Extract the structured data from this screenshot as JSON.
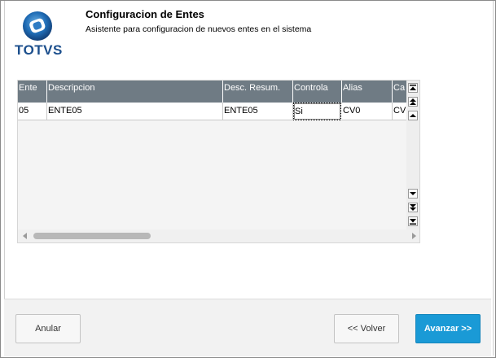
{
  "header": {
    "logo_text": "TOTVS",
    "title": "Configuracion de Entes",
    "subtitle": "Asistente para configuracion de nuevos entes en el sistema"
  },
  "grid": {
    "columns": [
      "Ente",
      "Descripcion",
      "Desc. Resum.",
      "Controla",
      "Alias",
      "Ca"
    ],
    "rows": [
      [
        "05",
        "ENTE05",
        "ENTE05",
        "Si",
        "CV0",
        "CV"
      ]
    ]
  },
  "footer": {
    "cancel_label": "Anular",
    "back_label": "<< Volver",
    "next_label": "Avanzar >>"
  },
  "colors": {
    "header_bg": "#6f7b84",
    "primary": "#1a9ad6",
    "brand": "#1c4f8d"
  }
}
